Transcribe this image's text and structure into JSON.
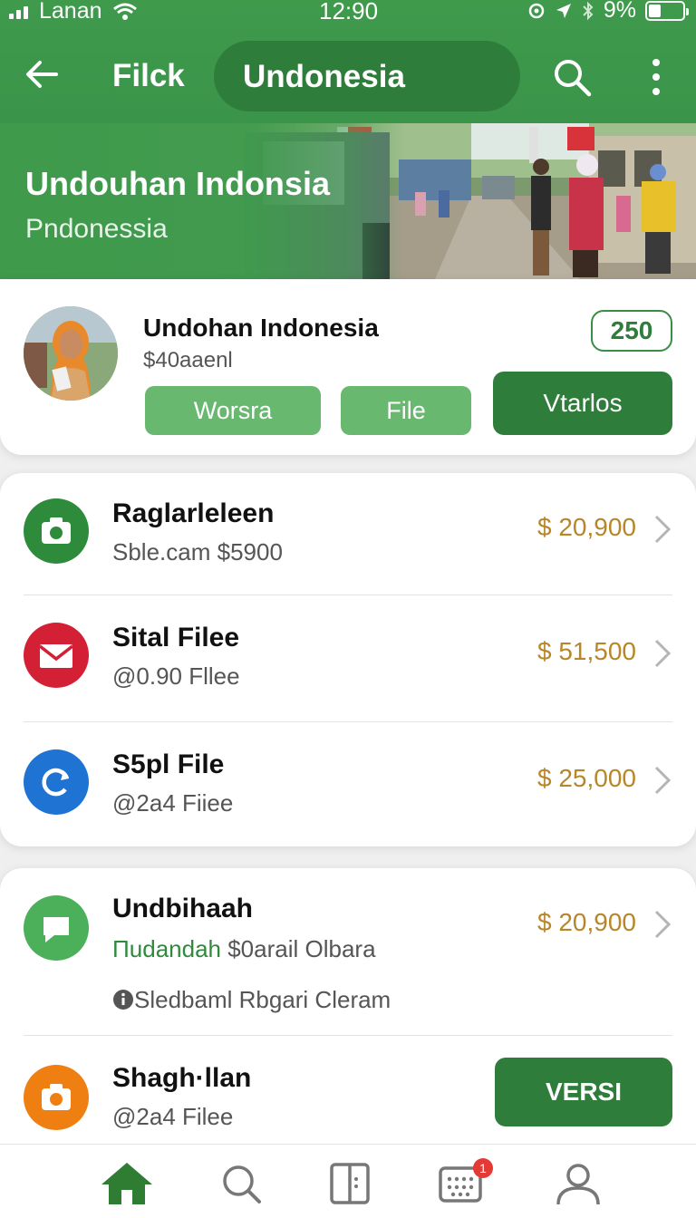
{
  "status_bar": {
    "carrier": "Lanan",
    "time": "12:90",
    "battery": "9%",
    "battery_level": 0.35
  },
  "appbar": {
    "title": "Filck",
    "search_value": "Undonesia"
  },
  "hero": {
    "title": "Undouhan Indonsia",
    "subtitle": "Pndonessia"
  },
  "profile": {
    "name": "Undohan Indonesia",
    "sub": "$40aaenl",
    "count": "250",
    "buttons": {
      "worsra": "Worsra",
      "file": "File",
      "vtarlos": "Vtarlos"
    }
  },
  "list1": [
    {
      "icon": "camera-icon",
      "color": "#2e8b3c",
      "title": "Raglarleleen",
      "sub": "Sble.cam  $5900",
      "amount": "$ 20,900"
    },
    {
      "icon": "mail-icon",
      "color": "#d32035",
      "title": "Sital Filee",
      "sub": "@0.90 Fllee",
      "amount": "$ 51,500"
    },
    {
      "icon": "sync-icon",
      "color": "#1f73d2",
      "title": "S5pl File",
      "sub": "@2a4 Fiiee",
      "amount": "$ 25,000"
    }
  ],
  "list2": {
    "row1": {
      "icon": "chat-icon",
      "color": "#4caf5a",
      "title": "Undbihaah",
      "sub_accent": "Πudandah",
      "sub_rest": " $0arail Olbara",
      "note": "Sledbaml Rbgari Cleram",
      "amount": "$ 20,900"
    },
    "row2": {
      "icon": "camera-icon",
      "color": "#f07f12",
      "title": "Shagh·llan",
      "sub": "@2a4 Filee",
      "button": "VERSI"
    }
  },
  "bottom_nav": {
    "items": [
      "home-icon",
      "search-icon",
      "library-icon",
      "calendar-icon",
      "profile-icon"
    ],
    "active": "home-icon",
    "calendar_badge": "1"
  },
  "colors": {
    "brand_green": "#3f9a4c",
    "dark_green": "#2f7d3b",
    "amount_gold": "#b8862a"
  }
}
